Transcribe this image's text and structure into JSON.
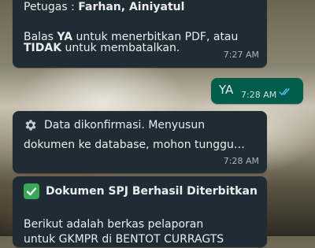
{
  "messages": [
    {
      "direction": "incoming",
      "line1_prefix": "Petugas : ",
      "line1_names": "Farhan, Ainiyatul",
      "line2_prefix": "Balas ",
      "line2_keyword": "YA",
      "line2_rest": " untuk menerbitkan PDF, atau",
      "line3_keyword": "TIDAK",
      "line3_rest": " untuk membatalkan.",
      "time": "7:27 AM"
    },
    {
      "direction": "outgoing",
      "text": "YA",
      "time": "7:28 AM",
      "status": "read"
    },
    {
      "direction": "incoming",
      "icon": "gear-icon",
      "line1": "Data dikonfirmasi. Menyusun",
      "line2": "dokumen ke database, mohon tunggu…",
      "time": "7:28 AM"
    },
    {
      "direction": "incoming",
      "icon": "check-mark-button-icon",
      "heading": "Dokumen SPJ Berhasil Diterbitkan",
      "line2": "Berikut adalah berkas pelaporan",
      "line3": "untuk GKMPR di BENTOT CURRAGTS"
    }
  ],
  "colors": {
    "incoming_bubble": "#1f2c34",
    "outgoing_bubble": "#005c4b",
    "text": "#e9edef",
    "read_ticks": "#53bdeb"
  }
}
